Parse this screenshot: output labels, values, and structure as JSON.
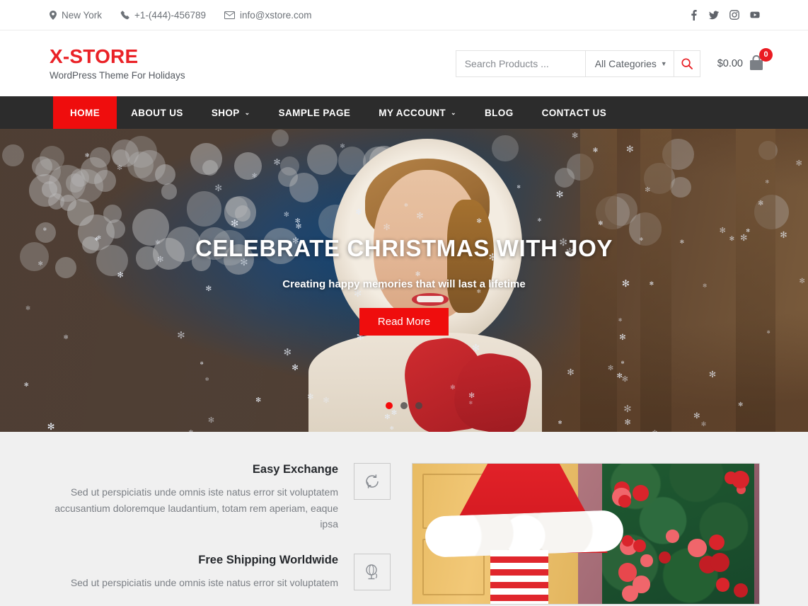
{
  "topbar": {
    "location": "New York",
    "phone": "+1-(444)-456789",
    "email": "info@xstore.com",
    "social": [
      {
        "name": "facebook-icon",
        "label": "Facebook"
      },
      {
        "name": "twitter-icon",
        "label": "Twitter"
      },
      {
        "name": "instagram-icon",
        "label": "Instagram"
      },
      {
        "name": "youtube-icon",
        "label": "Youtube"
      }
    ]
  },
  "header": {
    "logo_title": "X-STORE",
    "logo_subtitle": "WordPress Theme For Holidays",
    "search_placeholder": "Search Products ...",
    "search_value": "",
    "category_selected": "All Categories",
    "cart_amount": "$0.00",
    "cart_count": "0"
  },
  "nav": {
    "items": [
      {
        "label": "HOME",
        "active": true,
        "has_dropdown": false
      },
      {
        "label": "ABOUT US",
        "active": false,
        "has_dropdown": false
      },
      {
        "label": "SHOP",
        "active": false,
        "has_dropdown": true
      },
      {
        "label": "SAMPLE PAGE",
        "active": false,
        "has_dropdown": false
      },
      {
        "label": "MY ACCOUNT",
        "active": false,
        "has_dropdown": true
      },
      {
        "label": "BLOG",
        "active": false,
        "has_dropdown": false
      },
      {
        "label": "CONTACT US",
        "active": false,
        "has_dropdown": false
      }
    ]
  },
  "hero": {
    "title": "CELEBRATE CHRISTMAS WITH JOY",
    "subtitle": "Creating happy memories that will last a lifetime",
    "button_label": "Read More",
    "slide_count": 3,
    "active_slide": 1
  },
  "features": [
    {
      "title": "Easy Exchange",
      "description": "Sed ut perspiciatis unde omnis iste natus error sit voluptatem accusantium doloremque laudantium, totam rem aperiam, eaque ipsa",
      "icon": "exchange-icon"
    },
    {
      "title": "Free Shipping Worldwide",
      "description": "Sed ut perspiciatis unde omnis iste natus error sit voluptatem",
      "icon": "globe-icon"
    }
  ],
  "colors": {
    "brand_red": "#ea2227",
    "nav_dark": "#2c2c2c",
    "accent_red": "#ef0d0d",
    "section_bg": "#f0f0f0",
    "muted_text": "#7b7f85"
  }
}
